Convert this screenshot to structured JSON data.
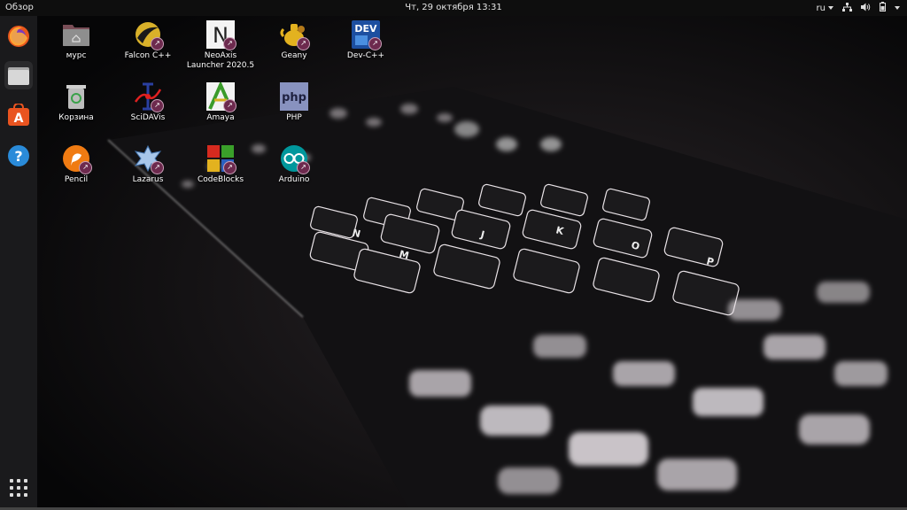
{
  "topbar": {
    "activities": "Обзор",
    "clock": "Чт, 29 октября  13:31",
    "lang": "ru",
    "icons": [
      "network-icon",
      "volume-icon",
      "battery-icon",
      "power-icon"
    ]
  },
  "dock": {
    "items": [
      "firefox-icon",
      "files-icon",
      "software-center-icon",
      "help-icon"
    ],
    "show_apps": "app-grid-icon"
  },
  "desktop": {
    "icons": [
      {
        "label": "мурс",
        "icon": "home-folder-icon"
      },
      {
        "label": "Falcon C++",
        "icon": "falcon-icon"
      },
      {
        "label": "NeoAxis Launcher 2020.5",
        "icon": "neoaxis-icon"
      },
      {
        "label": "Geany",
        "icon": "geany-icon"
      },
      {
        "label": "Dev-C++",
        "icon": "devcpp-icon"
      },
      {
        "label": "Корзина",
        "icon": "trash-icon"
      },
      {
        "label": "SciDAVis",
        "icon": "scidavis-icon"
      },
      {
        "label": "Amaya",
        "icon": "amaya-icon"
      },
      {
        "label": "PHP",
        "icon": "php-icon"
      },
      {
        "label": "Pencil",
        "icon": "pencil-icon"
      },
      {
        "label": "Lazarus",
        "icon": "lazarus-icon"
      },
      {
        "label": "CodeBlocks",
        "icon": "codeblocks-icon"
      },
      {
        "label": "Arduino",
        "icon": "arduino-icon"
      }
    ],
    "icon_texts": {
      "devcpp": "DEV",
      "php": "php"
    }
  },
  "colors": {
    "panel": "#0e0e0e",
    "dock": "#1c1c1e",
    "badge": "#6d2a4e",
    "accent_orange": "#e95420"
  }
}
